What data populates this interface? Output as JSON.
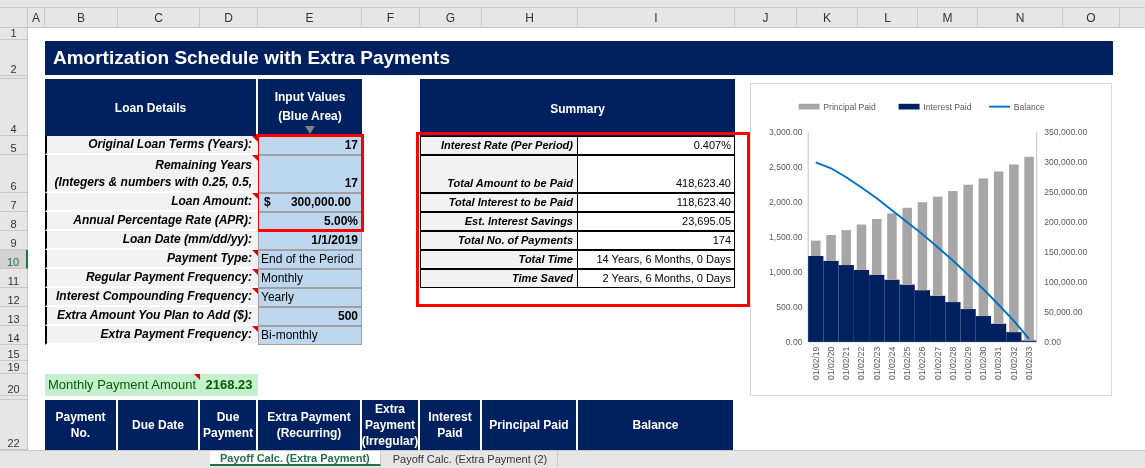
{
  "columns": [
    "A",
    "B",
    "C",
    "D",
    "E",
    "F",
    "G",
    "H",
    "I",
    "J",
    "K",
    "L",
    "M",
    "N",
    "O"
  ],
  "rows": [
    {
      "label": "1",
      "selected": false
    },
    {
      "label": "2",
      "selected": false
    },
    {
      "label": "4",
      "selected": false
    },
    {
      "label": "5",
      "selected": false
    },
    {
      "label": "6",
      "selected": false
    },
    {
      "label": "7",
      "selected": false
    },
    {
      "label": "8",
      "selected": false
    },
    {
      "label": "9",
      "selected": false
    },
    {
      "label": "10",
      "selected": true
    },
    {
      "label": "11",
      "selected": false
    },
    {
      "label": "12",
      "selected": false
    },
    {
      "label": "13",
      "selected": false
    },
    {
      "label": "14",
      "selected": false
    },
    {
      "label": "15",
      "selected": false
    },
    {
      "label": "19",
      "selected": false
    },
    {
      "label": "20",
      "selected": false
    },
    {
      "label": "22",
      "selected": false
    }
  ],
  "title": "Amortization Schedule with Extra Payments",
  "loan_details": {
    "header": "Loan Details",
    "input_header": "Input Values (Blue Area)",
    "fields": [
      {
        "label": "Original Loan Terms (Years):",
        "value": "17",
        "kind": "number",
        "comment": true
      },
      {
        "label": "Remaining Years\n(Integers & numbers with 0.25, 0.5,",
        "value": "17",
        "kind": "number",
        "comment": true
      },
      {
        "label": "Loan Amount:",
        "symbol": "$",
        "value": "300,000.00",
        "kind": "currency",
        "comment": true
      },
      {
        "label": "Annual Percentage Rate (APR):",
        "value": "5.00%",
        "kind": "number",
        "comment": false
      },
      {
        "label": "Loan Date (mm/dd/yy):",
        "value": "1/1/2019",
        "kind": "number",
        "comment": false
      },
      {
        "label": "Payment Type:",
        "value": "End of the Period",
        "kind": "text",
        "comment": true
      },
      {
        "label": "Regular Payment Frequency:",
        "value": "Monthly",
        "kind": "text",
        "comment": true
      },
      {
        "label": "Interest Compounding Frequency:",
        "value": "Yearly",
        "kind": "text",
        "comment": true
      },
      {
        "label": "Extra Amount You Plan to Add ($):",
        "value": "500",
        "kind": "number",
        "comment": false
      },
      {
        "label": "Extra Payment Frequency:",
        "value": "Bi-monthly",
        "kind": "text",
        "comment": true
      }
    ]
  },
  "summary": {
    "header": "Summary",
    "rows": [
      {
        "label": "Interest Rate (Per Period)",
        "value": "0.407%"
      },
      {
        "label": "Total Amount to be Paid",
        "value": "418,623.40"
      },
      {
        "label": "Total Interest to be Paid",
        "value": "118,623.40"
      },
      {
        "label": "Est. Interest Savings",
        "value": "23,695.05"
      },
      {
        "label": "Total No. of Payments",
        "value": "174"
      },
      {
        "label": "Total Time",
        "value": "14 Years, 6 Months, 0 Days"
      },
      {
        "label": "Time Saved",
        "value": "2 Years, 6 Months, 0 Days"
      }
    ]
  },
  "monthly_payment": {
    "label": "Monthly Payment Amount",
    "value": "2168.23",
    "comment": true
  },
  "schedule": {
    "columns": [
      "Payment No.",
      "Due Date",
      "Due Payment",
      "Extra Payment (Recurring)",
      "Extra Payment (Irregular)",
      "Interest Paid",
      "Principal Paid",
      "Balance"
    ]
  },
  "chart": {
    "bars": {
      "chart_data": {
        "type": "bar",
        "stacked": true,
        "categories": [
          "01/02/19",
          "01/02/20",
          "01/02/21",
          "01/02/22",
          "01/02/23",
          "01/02/24",
          "01/02/25",
          "01/02/26",
          "01/02/27",
          "01/02/28",
          "01/02/29",
          "01/02/30",
          "01/02/31",
          "01/02/32",
          "01/02/33"
        ],
        "series": [
          {
            "name": "Interest Paid",
            "color": "#002060",
            "values": [
              1230,
              1160,
              1100,
              1030,
              960,
              890,
              820,
              740,
              660,
              570,
              470,
              370,
              260,
              140,
              20
            ]
          },
          {
            "name": "Principal Paid",
            "color": "#a6a6a6",
            "values": [
              220,
              370,
              500,
              650,
              800,
              950,
              1100,
              1260,
              1420,
              1590,
              1780,
              1970,
              2180,
              2400,
              2630
            ]
          }
        ],
        "legend": "top",
        "ylim": [
          0,
          3000
        ],
        "yticks": [
          {
            "value": 0,
            "label": "0.00"
          },
          {
            "value": 500,
            "label": "500.00"
          },
          {
            "value": 1000,
            "label": "1,000.00"
          },
          {
            "value": 1500,
            "label": "1,500.00"
          },
          {
            "value": 2000,
            "label": "2,000.00"
          },
          {
            "value": 2500,
            "label": "2,500.00"
          },
          {
            "value": 3000,
            "label": "3,000.00"
          }
        ]
      }
    },
    "balance": {
      "chart_data": {
        "type": "line",
        "series": [
          {
            "name": "Balance",
            "color": "#0070c0",
            "values": [
              300000,
              290000,
              275000,
              258000,
              240000,
              220000,
              200000,
              180000,
              158000,
              136000,
              112000,
              88000,
              62000,
              35000,
              5000
            ]
          }
        ],
        "ylim": [
          0,
          350000
        ],
        "yticks": [
          {
            "value": 0,
            "label": "0.00"
          },
          {
            "value": 50000,
            "label": "50,000.00"
          },
          {
            "value": 100000,
            "label": "100,000.00"
          },
          {
            "value": 150000,
            "label": "150,000.00"
          },
          {
            "value": 200000,
            "label": "200,000.00"
          },
          {
            "value": 250000,
            "label": "250,000.00"
          },
          {
            "value": 300000,
            "label": "300,000.00"
          },
          {
            "value": 350000,
            "label": "350,000.00"
          }
        ]
      }
    }
  },
  "sheet_tabs": [
    {
      "label": "Payoff Calc. (Extra Payment)",
      "selected": true
    },
    {
      "label": "Payoff Calc. (Extra Payment (2)",
      "selected": false
    }
  ]
}
